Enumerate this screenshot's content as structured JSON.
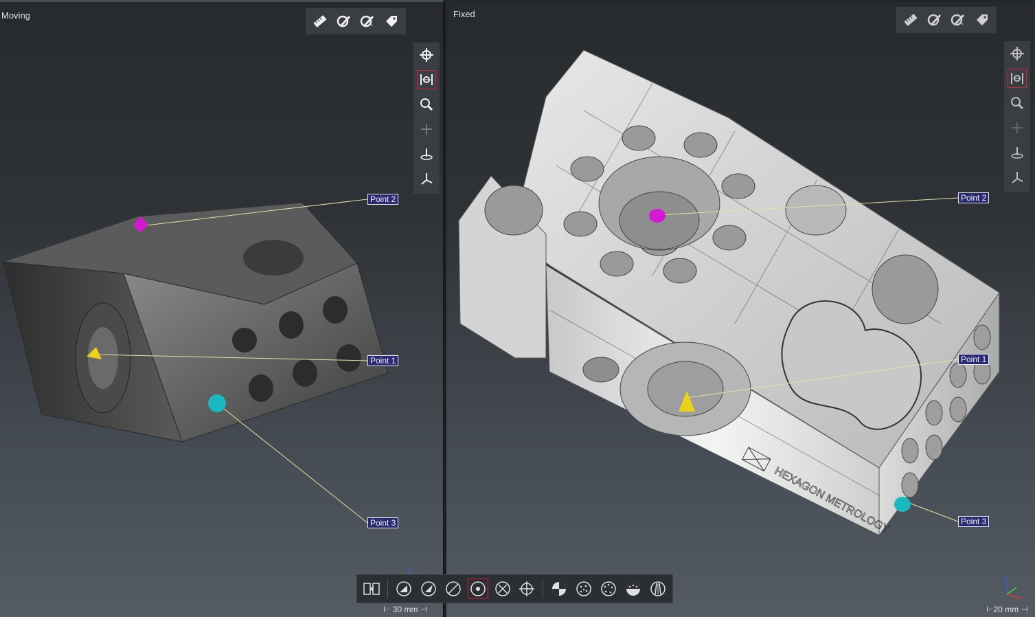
{
  "moving": {
    "title": "Moving",
    "scale": "⊢ 30 mm ⊣",
    "points": [
      "Point 2",
      "Point 1",
      "Point 3"
    ]
  },
  "fixed": {
    "title": "Fixed",
    "scale": "⊢20 mm ⊣",
    "points": [
      "Point 2",
      "Point 1",
      "Point 3"
    ],
    "logo_text": "HEXAGON METROLOGY"
  },
  "top_toolbar_icons": [
    "ruler-icon",
    "measure-pen-icon",
    "annotate-pen-icon",
    "tag-icon"
  ],
  "side_toolbar_icons": [
    "pan-icon",
    "fit-view-icon",
    "zoom-icon",
    "center-icon",
    "plane-icon",
    "axes-icon"
  ],
  "bottom_toolbar_icons": [
    "split-view-icon",
    "plane-left-icon",
    "plane-right-icon",
    "line-icon",
    "circle-point-icon",
    "cross-icon",
    "target-icon",
    "quadrant-icon",
    "dots-circle-icon",
    "dots-ring-icon",
    "sphere-dots-icon",
    "cylinder-icon"
  ],
  "axis_z": "Z",
  "colors": {
    "label_bg": "#2a2a73",
    "active_border": "#d0243a",
    "point1": "#e8d21a",
    "point2": "#d21ad2",
    "point3": "#1ab8c0"
  }
}
